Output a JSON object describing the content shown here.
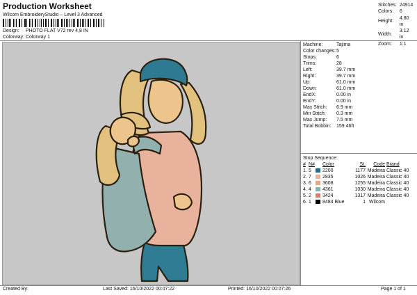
{
  "header": {
    "title": "Production Worksheet",
    "subtitle": "Wilcom EmbroideryStudio – Level 3 Advanced",
    "design_label": "Design:",
    "design_value": "PHOTO FLAT V72 rev 4,8 IN",
    "colorway_label": "Colorway:",
    "colorway_value": "Colorway 1",
    "stats": [
      {
        "label": "Stitches:",
        "value": "24914"
      },
      {
        "label": "Colors:",
        "value": "6"
      },
      {
        "label": "Height:",
        "value": "4.80 in"
      },
      {
        "label": "Width:",
        "value": "3.12 in"
      },
      {
        "label": "Zoom:",
        "value": "1:1"
      }
    ]
  },
  "info": [
    {
      "label": "Machine:",
      "value": "Tajima"
    },
    {
      "label": "Color changes:",
      "value": "5"
    },
    {
      "label": "Stops:",
      "value": "6"
    },
    {
      "label": "Trims:",
      "value": "28"
    },
    {
      "label": "Left:",
      "value": "39.7 mm"
    },
    {
      "label": "Right:",
      "value": "39.7 mm"
    },
    {
      "label": "Up:",
      "value": "61.0 mm"
    },
    {
      "label": "Down:",
      "value": "61.0 mm"
    },
    {
      "label": "EndX:",
      "value": "0.00 in"
    },
    {
      "label": "EndY:",
      "value": "0.00 in"
    },
    {
      "label": "Max Stitch:",
      "value": "6.9 mm"
    },
    {
      "label": "Min Stitch:",
      "value": "0.3 mm"
    },
    {
      "label": "Max Jump:",
      "value": "7.5 mm"
    },
    {
      "label": "Total Bobbin:",
      "value": "159.46ft"
    }
  ],
  "stops": {
    "title": "Stop Sequence:",
    "headers": {
      "num": "#",
      "n": "N#",
      "color": "Color",
      "st": "St.",
      "code": "Code",
      "brand": "Brand"
    },
    "rows": [
      {
        "num": "1.",
        "n": "5",
        "swatch": "#1f6b8c",
        "color": "2200",
        "st": "1177",
        "code": "Madeira",
        "brand": "Classic 40"
      },
      {
        "num": "2.",
        "n": "7",
        "swatch": "#e6b69c",
        "color": "2835",
        "st": "1026",
        "code": "Madeira",
        "brand": "Classic 40"
      },
      {
        "num": "3.",
        "n": "6",
        "swatch": "#e8a888",
        "color": "3608",
        "st": "1255",
        "code": "Madeira",
        "brand": "Classic 40"
      },
      {
        "num": "4.",
        "n": "4",
        "swatch": "#8fb0b0",
        "color": "4361",
        "st": "1030",
        "code": "Madeira",
        "brand": "Classic 40"
      },
      {
        "num": "5.",
        "n": "2",
        "swatch": "#d4826e",
        "color": "3424",
        "st": "1317",
        "code": "Madeira",
        "brand": "Classic 40"
      },
      {
        "num": "6.",
        "n": "1",
        "swatch": "#000000",
        "color": "8484 Blue",
        "st": "1",
        "code": "Wilcom",
        "brand": ""
      }
    ]
  },
  "footer": {
    "created": "Created By:",
    "saved": "Last Saved: 16/10/2022 00:07:22",
    "printed": "Printed: 16/10/2022 00:07:26",
    "page": "Page 1 of 1"
  },
  "colors": {
    "preview_bg": "#c7c7c7",
    "hair": "#e2c07e",
    "beanie": "#2e7a93",
    "sweater": "#e9b29c",
    "dress": "#92b1ae",
    "jeans": "#2f7c94",
    "skin": "#ecc48c",
    "outline": "#2a2010"
  }
}
